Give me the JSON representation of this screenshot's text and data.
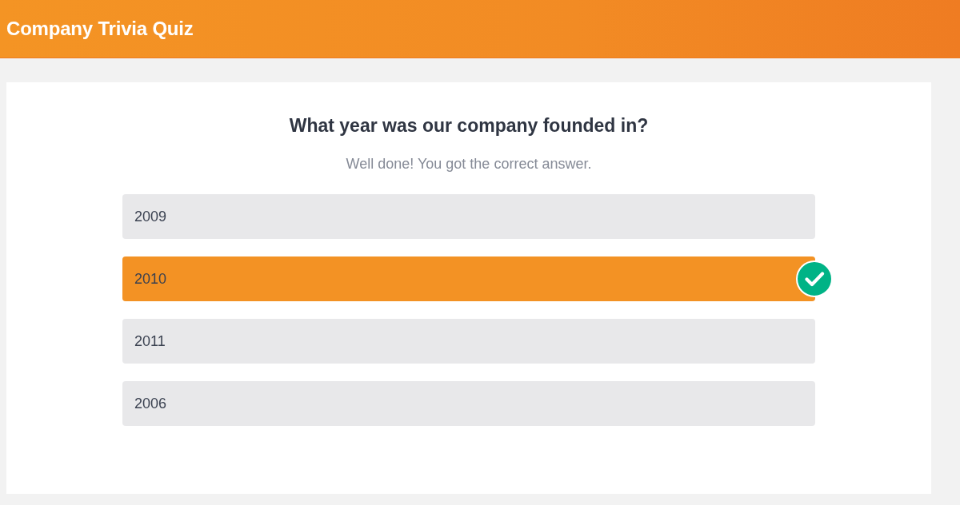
{
  "header": {
    "title": "Company Trivia Quiz"
  },
  "question": {
    "text": "What year was our company founded in?",
    "feedback": "Well done! You got the correct answer."
  },
  "options": [
    {
      "label": "2009",
      "selected": false,
      "correct": false
    },
    {
      "label": "2010",
      "selected": true,
      "correct": true
    },
    {
      "label": "2011",
      "selected": false,
      "correct": false
    },
    {
      "label": "2006",
      "selected": false,
      "correct": false
    }
  ]
}
